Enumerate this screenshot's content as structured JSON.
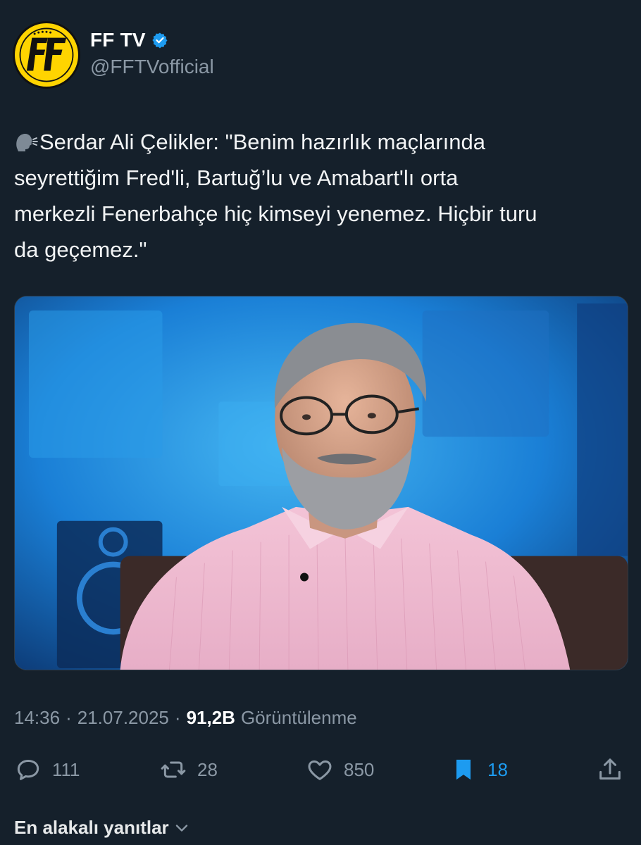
{
  "account": {
    "display_name": "FF TV",
    "handle": "@FFTVofficial",
    "avatar_text": "FF",
    "verified": true
  },
  "tweet": {
    "icon": "speaking-head-icon",
    "text": "Serdar Ali Çelikler: \"Benim hazırlık maçlarında\nseyrettiğim Fred'li, Bartuğ’lu ve Amabart'lı orta\nmerkezli Fenerbahçe hiç kimseyi yenemez. Hiçbir turu\nda geçemez.\""
  },
  "meta": {
    "time": "14:36",
    "separator": "·",
    "date": "21.07.2025",
    "views_count": "91,2B",
    "views_label": "Görüntülenme"
  },
  "actions": {
    "replies": "111",
    "reposts": "28",
    "likes": "850",
    "bookmarks": "18"
  },
  "sort": {
    "label": "En alakalı yanıtlar"
  },
  "colors": {
    "background": "#15202b",
    "accent": "#1d9bf0",
    "muted": "#8b98a5",
    "avatar_yellow": "#ffd400"
  }
}
